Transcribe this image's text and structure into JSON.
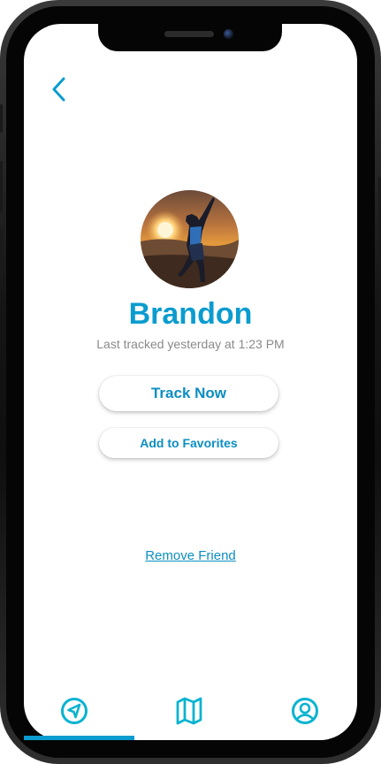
{
  "profile": {
    "name": "Brandon",
    "last_tracked": "Last tracked yesterday at 1:23 PM"
  },
  "actions": {
    "track_now": "Track Now",
    "add_favorites": "Add to Favorites",
    "remove_friend": "Remove Friend"
  },
  "nav": {
    "back_icon": "chevron-left-icon",
    "tabs": [
      {
        "icon": "navigation-arrow-icon",
        "selected": true
      },
      {
        "icon": "map-icon",
        "selected": false
      },
      {
        "icon": "user-circle-icon",
        "selected": false
      }
    ]
  },
  "colors": {
    "accent": "#0b9ccf",
    "tab_icon": "#0ab3d1",
    "secondary_text": "#8a8a8a"
  }
}
